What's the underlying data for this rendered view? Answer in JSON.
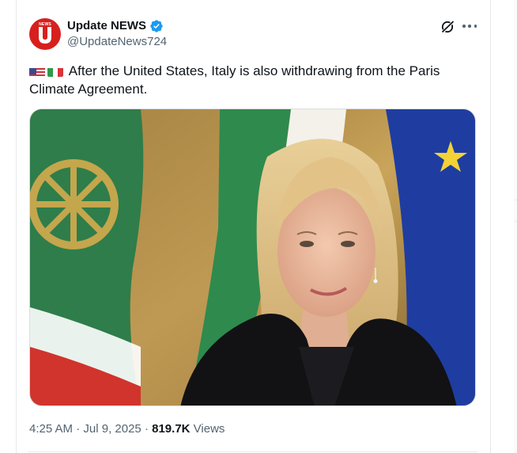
{
  "author": {
    "name": "Update NEWS",
    "handle": "@UpdateNews724",
    "avatar_text": "NEWS",
    "avatar_letter": "U",
    "verified": true
  },
  "post": {
    "flags": [
      "us-flag",
      "italy-flag"
    ],
    "text": "After the United States, Italy is also withdrawing from the Paris Climate Agreement."
  },
  "meta": {
    "time": "4:25 AM",
    "separator": "·",
    "date": "Jul 9, 2025",
    "views_count": "819.7K",
    "views_label": "Views"
  },
  "colors": {
    "brand_red": "#d7201d",
    "verified_blue": "#1d9bf0",
    "text_primary": "#0f1419",
    "text_secondary": "#536471"
  }
}
